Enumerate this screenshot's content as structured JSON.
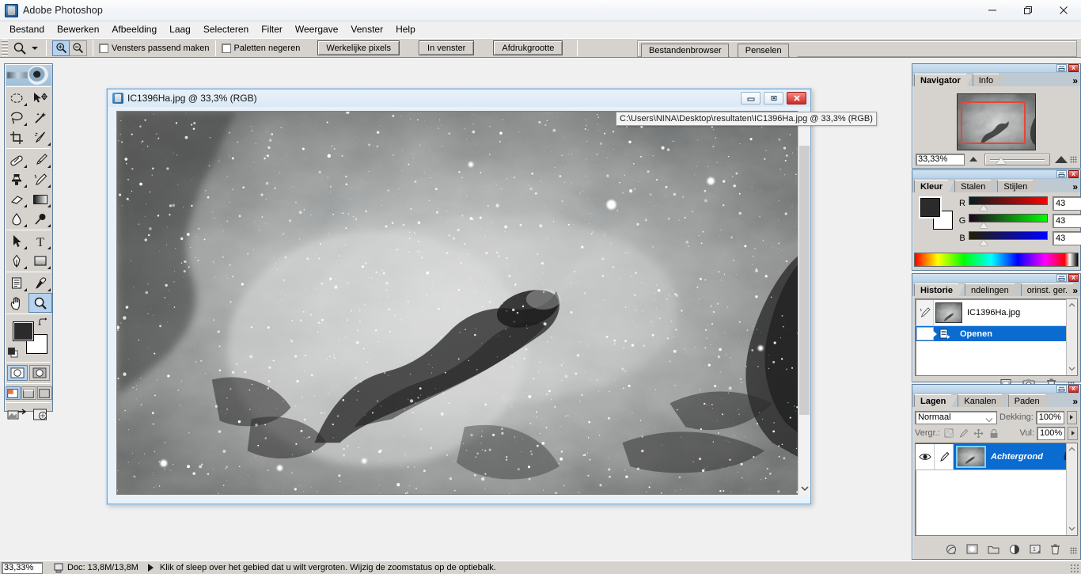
{
  "window": {
    "app_title": "Adobe Photoshop",
    "app_icon": "photoshop-app-icon",
    "minimize_label": "—",
    "maximize_label": "❐",
    "close_label": "✕"
  },
  "menubar": {
    "items": [
      {
        "label": "Bestand"
      },
      {
        "label": "Bewerken"
      },
      {
        "label": "Afbeelding"
      },
      {
        "label": "Laag"
      },
      {
        "label": "Selecteren"
      },
      {
        "label": "Filter"
      },
      {
        "label": "Weergave"
      },
      {
        "label": "Venster"
      },
      {
        "label": "Help"
      }
    ]
  },
  "optionsbar": {
    "active_tool_icon": "zoom-tool-icon",
    "preset_picker_icon": "chevron-down-icon",
    "zoom_in_icon": "zoom-in-icon",
    "zoom_out_icon": "zoom-out-icon",
    "checkboxes": [
      {
        "label": "Vensters passend maken",
        "checked": false
      },
      {
        "label": "Paletten negeren",
        "checked": false
      }
    ],
    "buttons": [
      {
        "label": "Werkelijke pixels"
      },
      {
        "label": "In venster"
      },
      {
        "label": "Afdrukgrootte"
      }
    ],
    "palette_well": {
      "tabs": [
        {
          "label": "Bestandenbrowser"
        },
        {
          "label": "Penselen"
        }
      ]
    }
  },
  "toolbox": {
    "banner_icon": "photoshop-eye-banner",
    "tools": [
      {
        "name": "marquee-elliptical-tool",
        "glyph": "ellipse",
        "has_flyout": true,
        "selected": false
      },
      {
        "name": "move-tool",
        "glyph": "move",
        "has_flyout": false,
        "selected": false
      },
      {
        "name": "lasso-tool",
        "glyph": "lasso",
        "has_flyout": true,
        "selected": false
      },
      {
        "name": "magic-wand-tool",
        "glyph": "wand",
        "has_flyout": false,
        "selected": false
      },
      {
        "name": "crop-tool",
        "glyph": "crop",
        "has_flyout": false,
        "selected": false
      },
      {
        "name": "slice-tool",
        "glyph": "slice",
        "has_flyout": true,
        "selected": false
      },
      {
        "name": "healing-brush-tool",
        "glyph": "heal",
        "has_flyout": true,
        "selected": false
      },
      {
        "name": "brush-tool",
        "glyph": "brush",
        "has_flyout": true,
        "selected": false
      },
      {
        "name": "clone-stamp-tool",
        "glyph": "stamp",
        "has_flyout": true,
        "selected": false
      },
      {
        "name": "history-brush-tool",
        "glyph": "historybrush",
        "has_flyout": true,
        "selected": false
      },
      {
        "name": "eraser-tool",
        "glyph": "eraser",
        "has_flyout": true,
        "selected": false
      },
      {
        "name": "gradient-tool",
        "glyph": "gradient",
        "has_flyout": true,
        "selected": false
      },
      {
        "name": "blur-tool",
        "glyph": "blur",
        "has_flyout": true,
        "selected": false
      },
      {
        "name": "dodge-tool",
        "glyph": "dodge",
        "has_flyout": true,
        "selected": false
      },
      {
        "name": "path-selection-tool",
        "glyph": "arrow",
        "has_flyout": true,
        "selected": false
      },
      {
        "name": "type-tool",
        "glyph": "type",
        "has_flyout": true,
        "selected": false
      },
      {
        "name": "pen-tool",
        "glyph": "pen",
        "has_flyout": true,
        "selected": false
      },
      {
        "name": "rectangle-shape-tool",
        "glyph": "rect",
        "has_flyout": true,
        "selected": false
      },
      {
        "name": "notes-tool",
        "glyph": "notes",
        "has_flyout": true,
        "selected": false
      },
      {
        "name": "eyedropper-tool",
        "glyph": "eyedropper",
        "has_flyout": true,
        "selected": false
      },
      {
        "name": "hand-tool",
        "glyph": "hand",
        "has_flyout": false,
        "selected": false
      },
      {
        "name": "zoom-tool",
        "glyph": "zoom",
        "has_flyout": false,
        "selected": true
      }
    ],
    "foreground_color": "#2b2b2b",
    "background_color": "#ffffff",
    "swap_icon": "swap-colors-icon",
    "default_colors_icon": "default-colors-icon",
    "mask_modes": [
      {
        "name": "standard-mask-mode",
        "selected": true
      },
      {
        "name": "quick-mask-mode",
        "selected": false
      }
    ],
    "screen_modes": [
      {
        "name": "standard-screen-mode",
        "selected": true
      },
      {
        "name": "full-screen-menubar-mode",
        "selected": false
      },
      {
        "name": "full-screen-mode",
        "selected": false
      }
    ],
    "jump_to_imageready_icon": "jump-to-imageready-icon"
  },
  "document": {
    "icon": "document-icon",
    "title": "IC1396Ha.jpg @ 33,3% (RGB)",
    "minimize_label": "—",
    "restore_label": "❐",
    "close_label": "✕",
    "tooltip": "C:\\Users\\NINA\\Desktop\\resultaten\\IC1396Ha.jpg @ 33,3% (RGB)",
    "scroll_down_icon": "chevron-down-icon"
  },
  "navigator": {
    "tabs": [
      {
        "label": "Navigator",
        "active": true
      },
      {
        "label": "Info",
        "active": false
      }
    ],
    "menu_icon": "palette-menu-icon",
    "minimize_icon": "minimize-icon",
    "close_icon": "close-icon",
    "zoom_value": "33,33%",
    "zoom_out_icon": "small-mountain-icon",
    "zoom_in_icon": "large-mountain-icon",
    "view_box_color": "#e8443a"
  },
  "color": {
    "tabs": [
      {
        "label": "Kleur",
        "active": true
      },
      {
        "label": "Stalen",
        "active": false
      },
      {
        "label": "Stijlen",
        "active": false
      }
    ],
    "menu_icon": "palette-menu-icon",
    "channels": [
      {
        "label": "R",
        "value": "43"
      },
      {
        "label": "G",
        "value": "43"
      },
      {
        "label": "B",
        "value": "43"
      }
    ],
    "foreground_color": "#2b2b2b",
    "background_color": "#ffffff"
  },
  "history": {
    "tabs": [
      {
        "label": "Historie",
        "active": true
      },
      {
        "label": "ndelingen",
        "active": false
      },
      {
        "label": "orinst. ger.",
        "active": false
      }
    ],
    "menu_icon": "palette-menu-icon",
    "snapshot": {
      "name": "IC1396Ha.jpg",
      "brush_icon": "history-brush-source-icon"
    },
    "states": [
      {
        "label": "Openen",
        "icon": "open-document-icon",
        "selected": true
      }
    ],
    "footer_icons": [
      {
        "name": "new-document-from-state-icon"
      },
      {
        "name": "new-snapshot-icon"
      },
      {
        "name": "delete-state-icon"
      }
    ]
  },
  "layers": {
    "tabs": [
      {
        "label": "Lagen",
        "active": true
      },
      {
        "label": "Kanalen",
        "active": false
      },
      {
        "label": "Paden",
        "active": false
      }
    ],
    "menu_icon": "palette-menu-icon",
    "blend_mode": "Normaal",
    "blend_mode_chevron": "chevron-down-icon",
    "opacity_label": "Dekking:",
    "opacity_value": "100%",
    "lock_label": "Vergr.:",
    "lock_icons": [
      {
        "name": "lock-transparency-icon"
      },
      {
        "name": "lock-image-pixels-icon"
      },
      {
        "name": "lock-position-icon"
      },
      {
        "name": "lock-all-icon"
      }
    ],
    "fill_label": "Vul:",
    "fill_value": "100%",
    "items": [
      {
        "name": "Achtergrond",
        "visible": true,
        "visibility_icon": "eye-icon",
        "link_icon": "brush-icon",
        "locked": true,
        "lock_icon": "lock-icon",
        "selected": true
      }
    ],
    "footer_icons": [
      {
        "name": "layer-style-icon"
      },
      {
        "name": "layer-mask-icon"
      },
      {
        "name": "new-group-icon"
      },
      {
        "name": "adjustment-layer-icon"
      },
      {
        "name": "new-layer-icon"
      },
      {
        "name": "delete-layer-icon"
      }
    ]
  },
  "statusbar": {
    "zoom_value": "33,33%",
    "doc_icon": "document-size-icon",
    "doc_info": "Doc: 13,8M/13,8M",
    "hint": "Klik of sleep over het gebied dat u wilt vergroten. Wijzig de zoomstatus op de optiebalk."
  }
}
